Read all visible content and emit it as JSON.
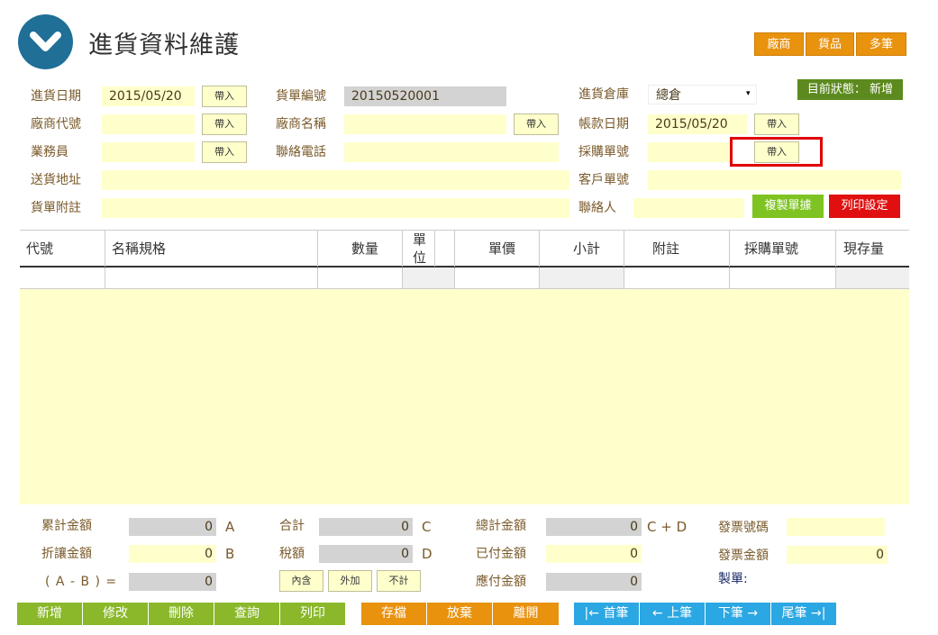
{
  "header": {
    "title": "進貨資料維護",
    "buttons": [
      "廠商",
      "貨品",
      "多筆"
    ],
    "status_label": "目前狀態：",
    "status_value": "新增",
    "status_text": "目前狀態： 新增"
  },
  "form": {
    "purchase_date_label": "進貨日期",
    "purchase_date_value": "2015/05/20",
    "vendor_code_label": "廠商代號",
    "vendor_code_value": "",
    "salesperson_label": "業務員",
    "salesperson_value": "",
    "delivery_address_label": "送貨地址",
    "delivery_address_value": "",
    "note_label": "貨單附註",
    "note_value": "",
    "order_no_label": "貨單編號",
    "order_no_value": "20150520001",
    "vendor_name_label": "廠商名稱",
    "vendor_name_value": "",
    "phone_label": "聯絡電話",
    "phone_value": "",
    "warehouse_label": "進貨倉庫",
    "warehouse_value": "總倉",
    "billing_date_label": "帳款日期",
    "billing_date_value": "2015/05/20",
    "po_no_label": "採購單號",
    "po_no_value": "",
    "customer_no_label": "客戶單號",
    "customer_no_value": "",
    "contact_label": "聯絡人",
    "contact_value": "",
    "import_label": "帶入",
    "copy_label": "複製單據",
    "print_setting_label": "列印設定"
  },
  "grid": {
    "columns": [
      "代號",
      "名稱規格",
      "數量",
      "單位",
      "單價",
      "小計",
      "附註",
      "採購單號",
      "現存量"
    ]
  },
  "summary": {
    "cum_amount_label": "累計金額",
    "cum_amount_value": "0",
    "cum_amount_suffix": "A",
    "discount_label": "折讓金額",
    "discount_value": "0",
    "discount_suffix": "B",
    "ab_label": "( A - B ) =",
    "ab_value": "0",
    "total_label": "合計",
    "total_value": "0",
    "total_suffix": "C",
    "tax_label": "稅額",
    "tax_value": "0",
    "tax_suffix": "D",
    "tax_incl": "內含",
    "tax_excl": "外加",
    "tax_none": "不計",
    "grand_label": "總計金額",
    "grand_value": "0",
    "grand_suffix": "C + D",
    "paid_label": "已付金額",
    "paid_value": "0",
    "due_label": "應付金額",
    "due_value": "0",
    "invoice_no_label": "發票號碼",
    "invoice_no_value": "",
    "invoice_amt_label": "發票金額",
    "invoice_amt_value": "0",
    "maker_label": "製單:"
  },
  "toolbar": {
    "green": [
      "新增",
      "修改",
      "刪除",
      "查詢",
      "列印"
    ],
    "orange": [
      "存檔",
      "放棄",
      "離開"
    ],
    "blue": [
      "|← 首筆",
      "← 上筆",
      "下筆 →",
      "尾筆 →|"
    ]
  },
  "colors": {
    "field_yellow": "#ffffcc",
    "field_grey": "#d3d3d3",
    "orange": "#e8920e",
    "green": "#8ab82a",
    "blue": "#2ba7e3",
    "red": "#e01010",
    "status_green": "#5c8a1e",
    "logo_blue": "#1f6f96"
  }
}
